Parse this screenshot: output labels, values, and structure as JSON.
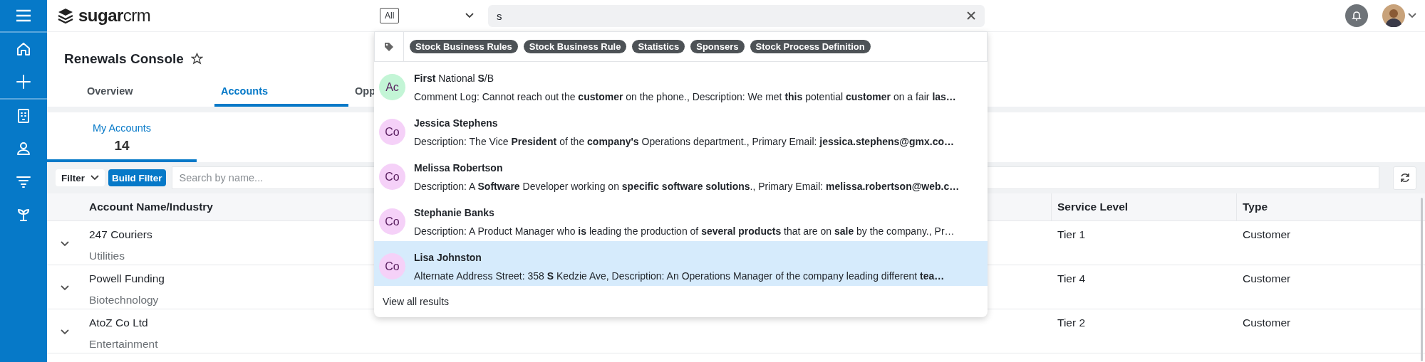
{
  "header": {
    "logo": "**sugar**crm",
    "search": {
      "module": "All",
      "value": "s"
    }
  },
  "suggestions": {
    "tags": [
      "Stock Business Rules",
      "Stock Business Rule",
      "Statistics",
      "Sponsers",
      "Stock Process Definition"
    ],
    "results": [
      {
        "badge": "Ac",
        "color": "#c3f5d6",
        "title": "**First** National **S**/B",
        "detail": "Comment Log: Cannot reach out the **customer** on the phone., Description: We met **this** potential **customer** on a fair **las…**",
        "selected": false
      },
      {
        "badge": "Co",
        "color": "#f5d1f8",
        "title": "**Jessica Stephens**",
        "detail": "Description: The Vice **President** of the **company's** Operations department., Primary Email: **jessica.stephens@gmx.co…**",
        "selected": false
      },
      {
        "badge": "Co",
        "color": "#f5d1f8",
        "title": "**Melissa Robertson**",
        "detail": "Description: A **Software** Developer working on **specific software solutions**., Primary Email: **melissa.robertson@web.c…**",
        "selected": false
      },
      {
        "badge": "Co",
        "color": "#f5d1f8",
        "title": "**Stephanie Banks**",
        "detail": "Description: A Product Manager who **is** leading the production of **several products** that are on **sale** by the company., Pr…",
        "selected": false
      },
      {
        "badge": "Co",
        "color": "#f5d1f8",
        "title": "**Lisa Johnston**",
        "detail": "Alternate Address Street: 358 **S** Kedzie Ave, Description: An Operations Manager of the company leading different **tea…**",
        "selected": true
      }
    ],
    "footer": "View all results"
  },
  "page": {
    "title": "Renewals Console",
    "favorite": false
  },
  "tabs": [
    {
      "label": "Overview",
      "selected": false
    },
    {
      "label": "Accounts",
      "selected": true
    },
    {
      "label": "Opp",
      "selected": false
    }
  ],
  "list_view": {
    "label": "My Accounts",
    "count": "14"
  },
  "filter": {
    "label": "Filter",
    "build_button": "Build Filter",
    "placeholder": "Search by name..."
  },
  "table": {
    "columns": [
      "Account Name/Industry",
      "Service Level",
      "Type"
    ],
    "rows": [
      {
        "name": "247 Couriers",
        "industry": "Utilities",
        "service_level": "Tier 1",
        "type": "Customer"
      },
      {
        "name": "Powell Funding",
        "industry": "Biotechnology",
        "service_level": "Tier 4",
        "type": "Customer"
      },
      {
        "name": "AtoZ Co Ltd",
        "industry": "Entertainment",
        "service_level": "Tier 2",
        "type": "Customer"
      }
    ]
  }
}
